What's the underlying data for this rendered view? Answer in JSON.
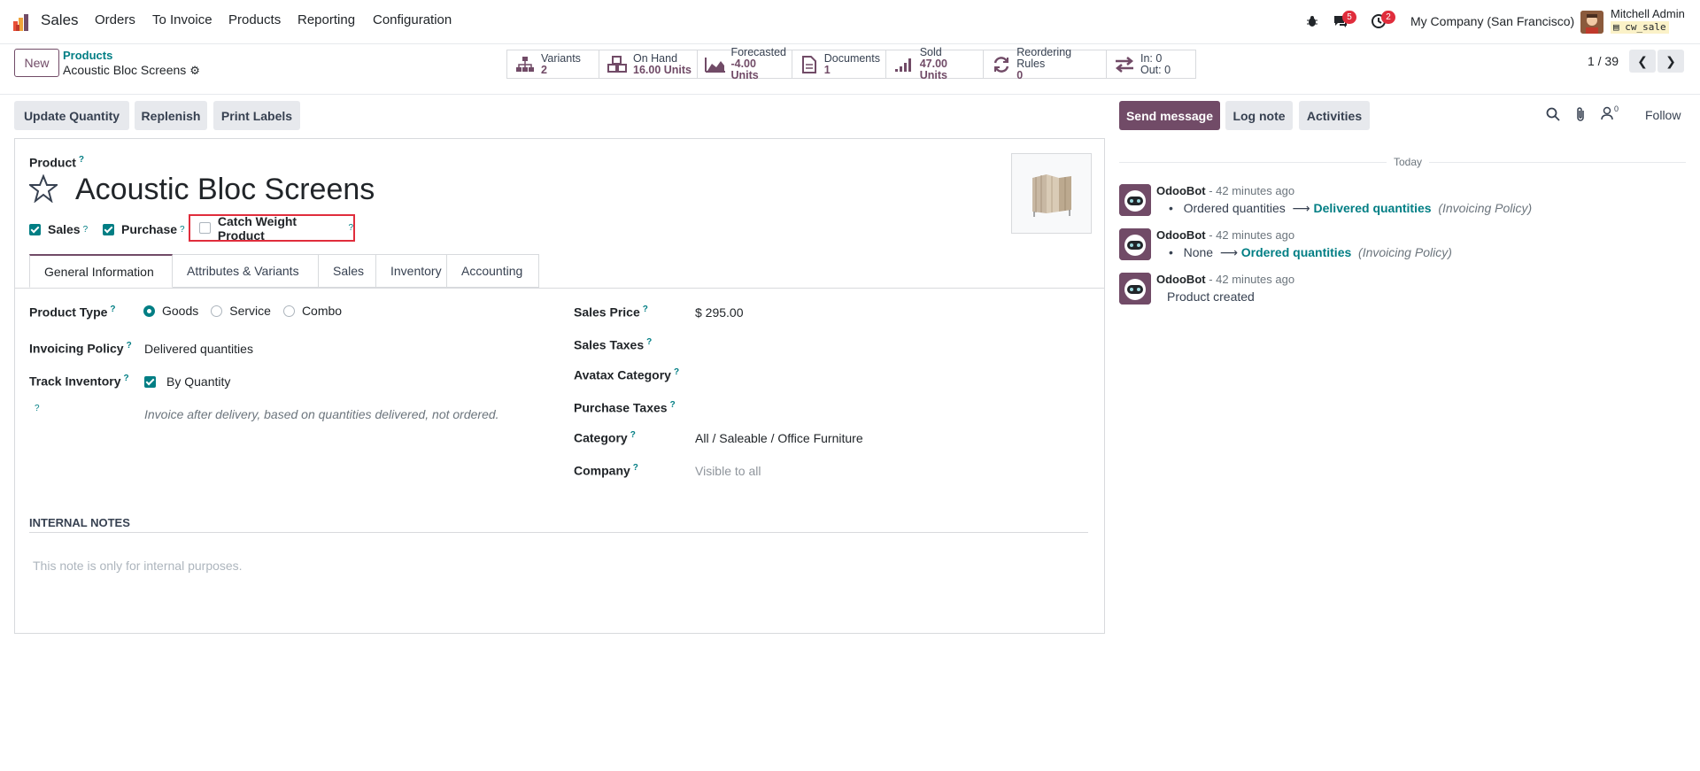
{
  "navbar": {
    "app_name": "Sales",
    "menu": [
      "Orders",
      "To Invoice",
      "Products",
      "Reporting",
      "Configuration"
    ],
    "messages_badge": "5",
    "activities_badge": "2",
    "company": "My Company (San Francisco)",
    "user_name": "Mitchell Admin",
    "database": "cw_sale"
  },
  "breadcrumb": {
    "parent": "Products",
    "current": "Acoustic Bloc Screens"
  },
  "new_button": "New",
  "smart_buttons": [
    {
      "label": "Variants",
      "value": "2",
      "icon": "sitemap-icon"
    },
    {
      "label": "On Hand",
      "value": "16.00 Units",
      "icon": "cubes-icon"
    },
    {
      "label": "Forecasted",
      "value": "-4.00 Units",
      "icon": "area-chart-icon"
    },
    {
      "label": "Documents",
      "value": "1",
      "icon": "file-icon"
    },
    {
      "label": "Sold",
      "value": "47.00 Units",
      "icon": "signal-icon"
    },
    {
      "label": "Reordering Rules",
      "value": "0",
      "icon": "refresh-icon"
    },
    {
      "label": "In: 0",
      "value": "Out: 0",
      "icon": "exchange-icon"
    }
  ],
  "pager": "1 / 39",
  "actions": [
    "Update Quantity",
    "Replenish",
    "Print Labels"
  ],
  "form": {
    "product_label": "Product",
    "product_name": "Acoustic Bloc Screens",
    "flags": {
      "sales": "Sales",
      "purchase": "Purchase",
      "catch_weight": "Catch Weight Product"
    },
    "tabs": [
      "General Information",
      "Attributes & Variants",
      "Sales",
      "Inventory",
      "Accounting"
    ],
    "left": {
      "product_type_label": "Product Type",
      "product_type_options": [
        "Goods",
        "Service",
        "Combo"
      ],
      "invoicing_policy_label": "Invoicing Policy",
      "invoicing_policy_value": "Delivered quantities",
      "track_inventory_label": "Track Inventory",
      "track_inventory_value": "By Quantity",
      "invoice_hint": "Invoice after delivery, based on quantities delivered, not ordered."
    },
    "right": {
      "sales_price_label": "Sales Price",
      "sales_price_value": "$ 295.00",
      "sales_taxes_label": "Sales Taxes",
      "avatax_label": "Avatax Category",
      "purchase_taxes_label": "Purchase Taxes",
      "category_label": "Category",
      "category_value": "All / Saleable / Office Furniture",
      "company_label": "Company",
      "company_value": "Visible to all"
    },
    "internal_notes_label": "INTERNAL NOTES",
    "internal_notes_placeholder": "This note is only for internal purposes."
  },
  "chatter": {
    "send_message": "Send message",
    "log_note": "Log note",
    "activities": "Activities",
    "followers_count": "0",
    "follow": "Follow",
    "date_separator": "Today",
    "messages": [
      {
        "author": "OdooBot",
        "time": "- 42 minutes ago",
        "old": "Ordered quantities",
        "new": "Delivered quantities",
        "field": "(Invoicing Policy)"
      },
      {
        "author": "OdooBot",
        "time": "- 42 minutes ago",
        "old": "None",
        "new": "Ordered quantities",
        "field": "(Invoicing Policy)"
      },
      {
        "author": "OdooBot",
        "time": "- 42 minutes ago",
        "body": "Product created"
      }
    ]
  },
  "colors": {
    "brand": "#714b67",
    "accent": "#017e84",
    "highlight": "#e02d3c"
  }
}
